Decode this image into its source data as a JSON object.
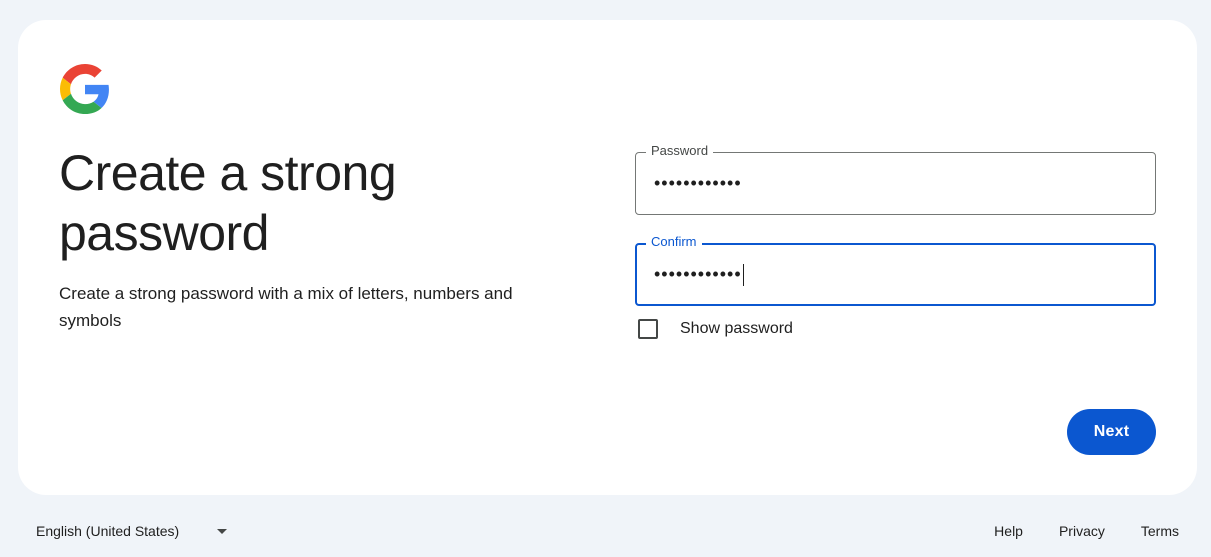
{
  "brand": {
    "logo_icon": "google-g-logo-icon",
    "colors": {
      "blue": "#4285F4",
      "red": "#EA4335",
      "yellow": "#FBBC05",
      "green": "#34A853"
    }
  },
  "heading": {
    "title": "Create a strong password",
    "subtitle": "Create a strong password with a mix of letters, numbers and symbols"
  },
  "form": {
    "password": {
      "label": "Password",
      "value": "••••••••••••"
    },
    "confirm": {
      "label": "Confirm",
      "value": "••••••••••••",
      "focused": true
    },
    "show_password": {
      "label": "Show password",
      "checked": false
    },
    "next_label": "Next"
  },
  "accent_color": "#0b57d0",
  "footer": {
    "language": "English (United States)",
    "links": {
      "help": "Help",
      "privacy": "Privacy",
      "terms": "Terms"
    }
  }
}
